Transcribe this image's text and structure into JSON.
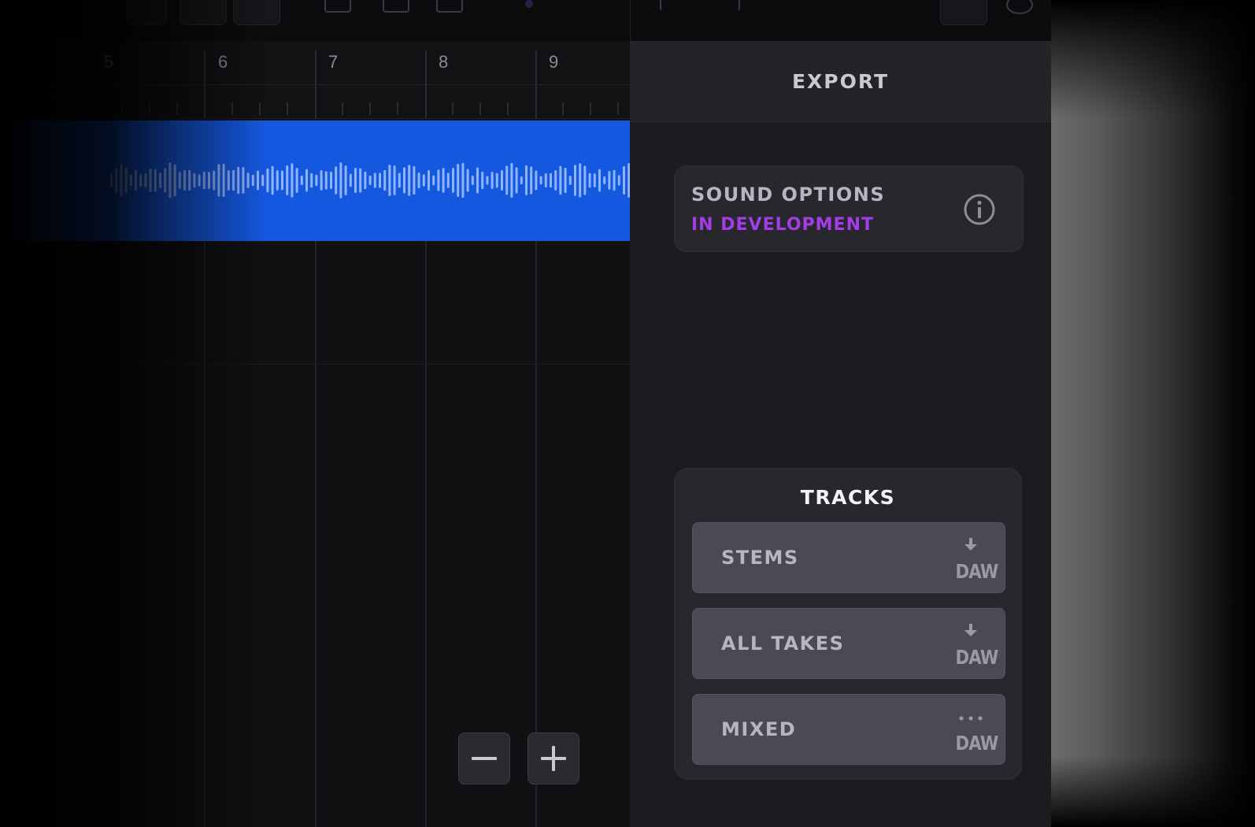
{
  "ruler": {
    "bars": [
      "5",
      "6",
      "7",
      "8",
      "9"
    ]
  },
  "zoom": {
    "out_label": "−",
    "in_label": "+"
  },
  "export_panel": {
    "title": "EXPORT",
    "sound_options": {
      "title": "SOUND OPTIONS",
      "status": "IN DEVELOPMENT",
      "status_color": "#a53de6"
    },
    "tracks": {
      "title": "TRACKS",
      "items": [
        {
          "label": "STEMS",
          "icon": "download-daw-icon",
          "daw": "DAW"
        },
        {
          "label": "ALL TAKES",
          "icon": "download-daw-icon",
          "daw": "DAW"
        },
        {
          "label": "MIXED",
          "icon": "more-daw-icon",
          "daw": "DAW"
        }
      ]
    }
  },
  "colors": {
    "clip": "#1558e0",
    "accent_purple": "#a53de6",
    "panel_bg": "#1c1c20"
  }
}
